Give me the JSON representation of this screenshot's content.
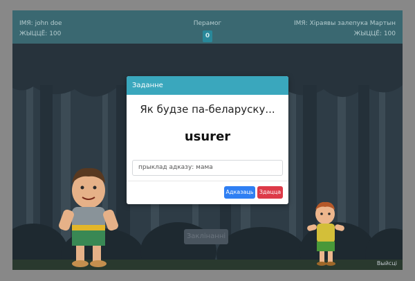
{
  "hud": {
    "player_name": "ІМЯ: john doe",
    "player_hp": "ЖЫЦЦЁ: 100",
    "wins_label": "Перамог",
    "wins_count": "0",
    "enemy_name": "ІМЯ: Хіраявы залепука Мартын",
    "enemy_hp": "ЖЫЦЦЁ: 100"
  },
  "scene": {
    "background_button_label": "Заклінанні",
    "exit_label": "Выйсці"
  },
  "modal": {
    "title": "Заданне",
    "question": "Як будзе па-беларуску...",
    "word": "usurer",
    "input_placeholder": "прыклад адказу: мама",
    "answer_button": "Адказаць",
    "give_up_button": "Здацца"
  },
  "colors": {
    "hud_bg": "#3b6a73",
    "modal_header": "#3aa7bd",
    "answer_button": "#2f7ff3",
    "give_up_button": "#dd3a48"
  }
}
